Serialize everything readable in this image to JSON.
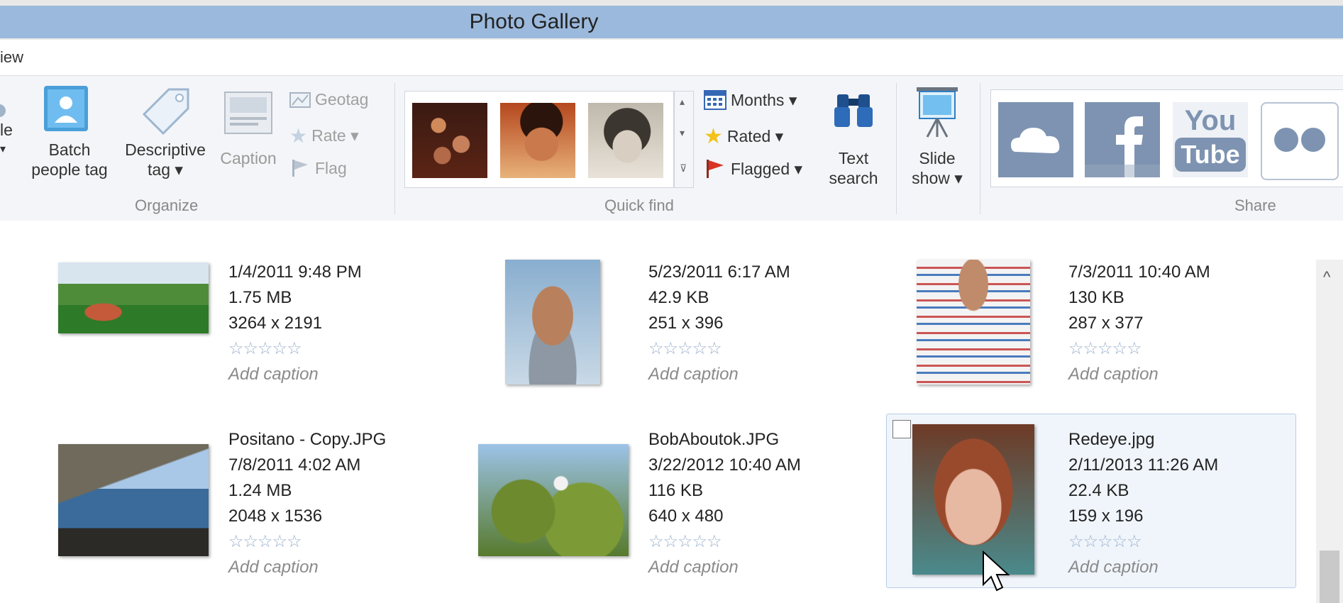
{
  "window": {
    "title": "Photo Gallery"
  },
  "menu": {
    "tab_partial": "iew"
  },
  "ribbon": {
    "organize": {
      "partial_label_1": "le",
      "partial_arrow": "▾",
      "batch_label_1": "Batch",
      "batch_label_2": "people tag",
      "descriptive_label_1": "Descriptive",
      "descriptive_label_2": "tag ▾",
      "caption_label": "Caption",
      "geotag_label": "Geotag",
      "rate_label": "Rate ▾",
      "flag_label": "Flag",
      "group_label": "Organize"
    },
    "quick_find": {
      "months_label": "Months ▾",
      "rated_label": "Rated ▾",
      "flagged_label": "Flagged ▾",
      "text_search_1": "Text",
      "text_search_2": "search",
      "group_label": "Quick find"
    },
    "slide_show": {
      "label_1": "Slide",
      "label_2": "show ▾"
    },
    "share": {
      "group_label": "Share",
      "youtube_1": "You",
      "youtube_2": "Tube"
    }
  },
  "photos": [
    {
      "filename": "",
      "date": "1/4/2011 9:48 PM",
      "size": "1.75 MB",
      "dimensions": "3264 x 2191",
      "stars": "☆☆☆☆☆",
      "caption": "Add caption"
    },
    {
      "filename": "",
      "date": "5/23/2011 6:17 AM",
      "size": "42.9 KB",
      "dimensions": "251 x 396",
      "stars": "☆☆☆☆☆",
      "caption": "Add caption"
    },
    {
      "filename": "",
      "date": "7/3/2011 10:40 AM",
      "size": "130 KB",
      "dimensions": "287 x 377",
      "stars": "☆☆☆☆☆",
      "caption": "Add caption"
    },
    {
      "filename": "Positano - Copy.JPG",
      "date": "7/8/2011 4:02 AM",
      "size": "1.24 MB",
      "dimensions": "2048 x 1536",
      "stars": "☆☆☆☆☆",
      "caption": "Add caption"
    },
    {
      "filename": "BobAboutok.JPG",
      "date": "3/22/2012 10:40 AM",
      "size": "116 KB",
      "dimensions": "640 x 480",
      "stars": "☆☆☆☆☆",
      "caption": "Add caption"
    },
    {
      "filename": "Redeye.jpg",
      "date": "2/11/2013 11:26 AM",
      "size": "22.4 KB",
      "dimensions": "159 x 196",
      "stars": "☆☆☆☆☆",
      "caption": "Add caption"
    }
  ],
  "scrollbar": {
    "up_arrow": "^"
  },
  "colors": {
    "title_band": "#9bb9dc",
    "ribbon": "#f3f5f8",
    "selection": "#f0f5fb",
    "share_tile": "#7d93b1"
  }
}
